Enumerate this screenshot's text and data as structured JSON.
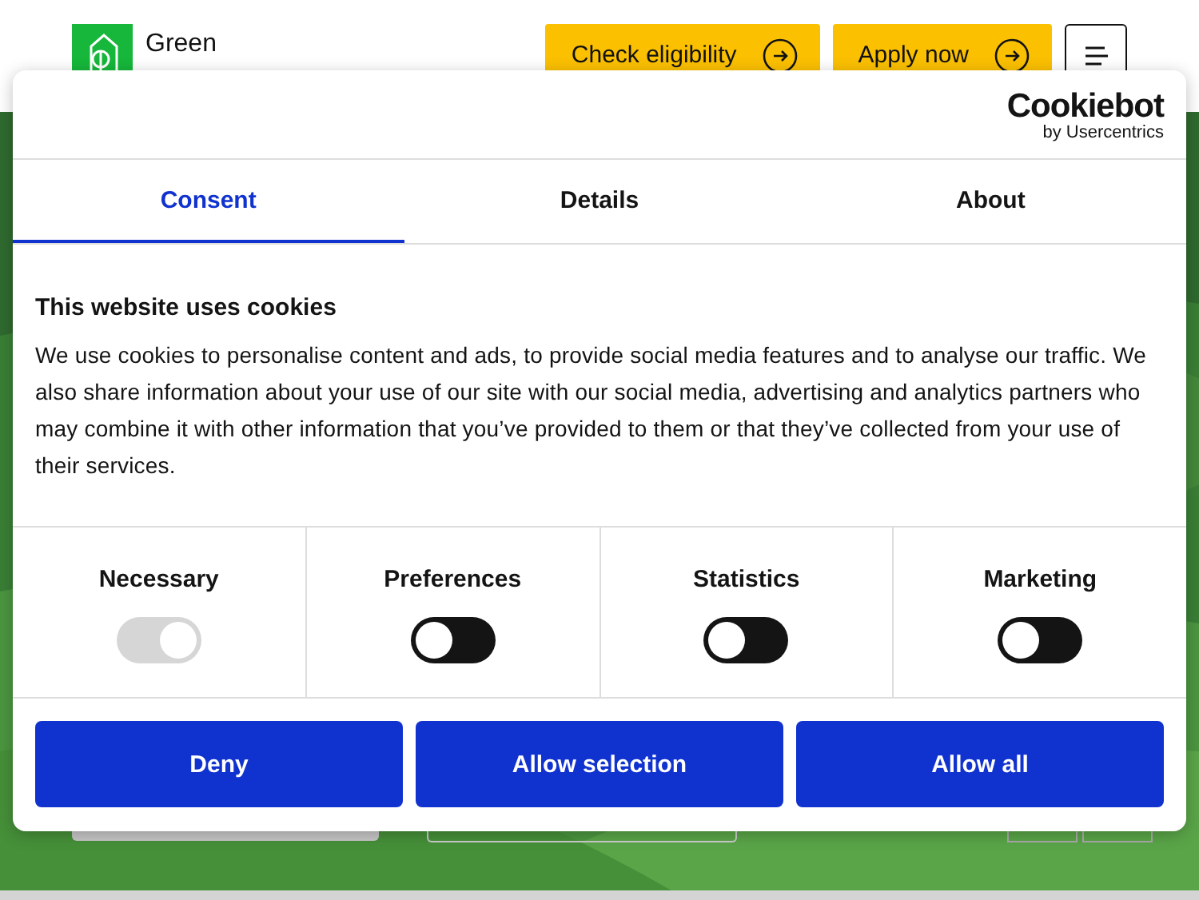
{
  "header": {
    "logo_lines": [
      "Green"
    ],
    "buttons": [
      {
        "label": "Check eligibility"
      },
      {
        "label": "Apply now"
      }
    ]
  },
  "dialog": {
    "brand": "Cookiebot",
    "brand_sub": "by Usercentrics",
    "tabs": [
      {
        "label": "Consent",
        "selected": true
      },
      {
        "label": "Details",
        "selected": false
      },
      {
        "label": "About",
        "selected": false
      }
    ],
    "heading": "This website uses cookies",
    "body": "We use cookies to personalise content and ads, to provide social media features and to analyse our traffic. We also share information about your use of our site with our social media, advertising and analytics partners who may combine it with other information that you’ve provided to them or that they’ve collected from your use of their services.",
    "categories": [
      {
        "label": "Necessary",
        "on": true,
        "disabled": true
      },
      {
        "label": "Preferences",
        "on": false,
        "disabled": false
      },
      {
        "label": "Statistics",
        "on": false,
        "disabled": false
      },
      {
        "label": "Marketing",
        "on": false,
        "disabled": false
      }
    ],
    "buttons": [
      "Deny",
      "Allow selection",
      "Allow all"
    ]
  }
}
